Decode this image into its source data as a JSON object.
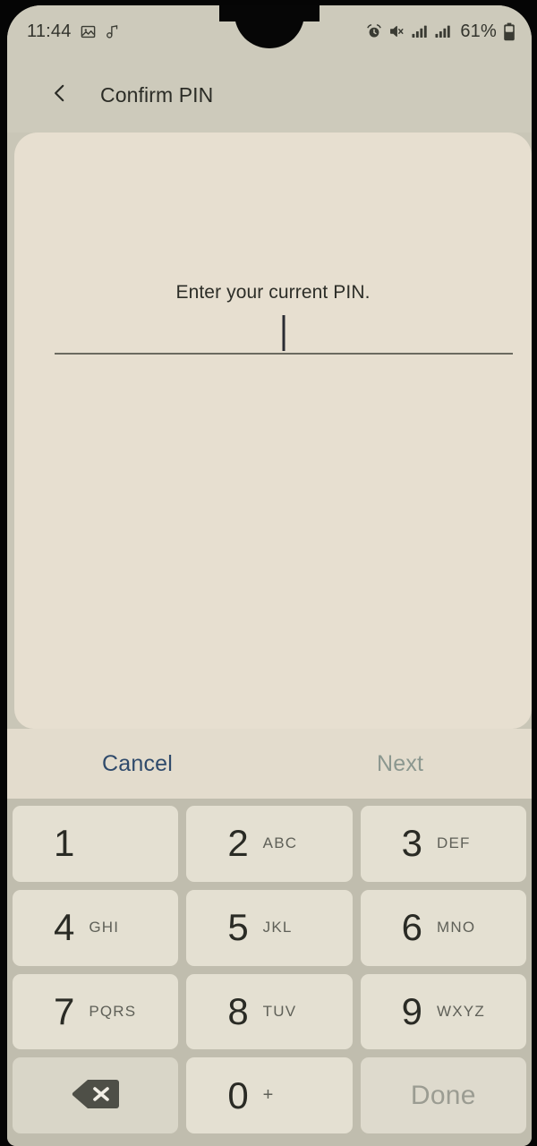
{
  "status_bar": {
    "time": "11:44",
    "left_icons": [
      "image-icon",
      "music-note-icon"
    ],
    "right_icons": [
      "alarm-icon",
      "mute-icon",
      "signal-bars-icon",
      "signal-bars-icon"
    ],
    "battery_percent": "61%",
    "battery_icon": "battery-icon"
  },
  "app_bar": {
    "back_icon": "chevron-left-icon",
    "title": "Confirm PIN"
  },
  "content": {
    "prompt": "Enter your current PIN.",
    "pin_value": "",
    "cursor_visible": true
  },
  "actions": {
    "cancel_label": "Cancel",
    "next_label": "Next",
    "cancel_color": "#2f4a6b",
    "next_color": "#8b978f",
    "next_enabled": false
  },
  "keypad": {
    "keys": [
      {
        "digit": "1",
        "letters": "",
        "name": "key-1"
      },
      {
        "digit": "2",
        "letters": "ABC",
        "name": "key-2"
      },
      {
        "digit": "3",
        "letters": "DEF",
        "name": "key-3"
      },
      {
        "digit": "4",
        "letters": "GHI",
        "name": "key-4"
      },
      {
        "digit": "5",
        "letters": "JKL",
        "name": "key-5"
      },
      {
        "digit": "6",
        "letters": "MNO",
        "name": "key-6"
      },
      {
        "digit": "7",
        "letters": "PQRS",
        "name": "key-7"
      },
      {
        "digit": "8",
        "letters": "TUV",
        "name": "key-8"
      },
      {
        "digit": "9",
        "letters": "WXYZ",
        "name": "key-9"
      }
    ],
    "backspace_icon": "backspace-icon",
    "zero_digit": "0",
    "zero_extra": "+",
    "done_label": "Done",
    "done_enabled": false
  },
  "colors": {
    "page_background": "#c9c6b7",
    "card_background": "#e7dfd0",
    "keypad_background": "#c0bdae",
    "key_background": "#e4e0d2",
    "text_primary": "#2d2e28"
  }
}
